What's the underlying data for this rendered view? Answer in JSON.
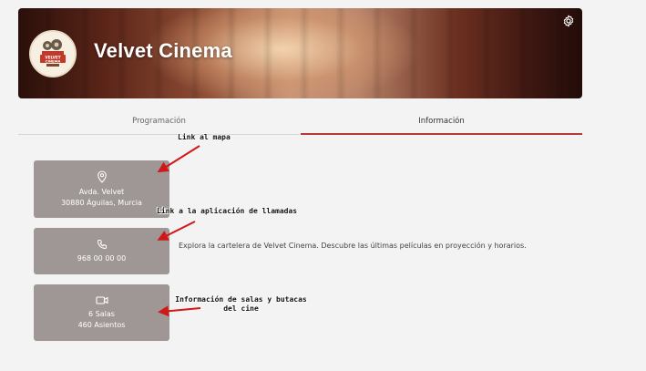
{
  "header": {
    "title": "Velvet Cinema",
    "logo_icon": "velvet-cinema-logo",
    "settings_icon": "gear-icon"
  },
  "tabs": [
    {
      "label": "Programación",
      "active": false
    },
    {
      "label": "Información",
      "active": true
    }
  ],
  "info": {
    "address": {
      "icon": "location-pin-icon",
      "line1": "Avda. Velvet",
      "line2": "30880 Águilas, Murcia"
    },
    "phone": {
      "icon": "phone-icon",
      "number": "968 00 00 00"
    },
    "rooms": {
      "icon": "video-camera-icon",
      "salas": "6 Salas",
      "seats": "460 Asientos"
    },
    "description": "Explora la cartelera de Velvet Cinema. Descubre las últimas películas en proyección y horarios."
  },
  "annotations": {
    "map_link": "Link al mapa",
    "call_link": "Link a la aplicación de llamadas",
    "rooms_info_line1": "Información de salas y butacas",
    "rooms_info_line2": "del cine"
  },
  "colors": {
    "accent": "#b33a3a",
    "card": "#9e9795",
    "arrow": "#d01818"
  }
}
